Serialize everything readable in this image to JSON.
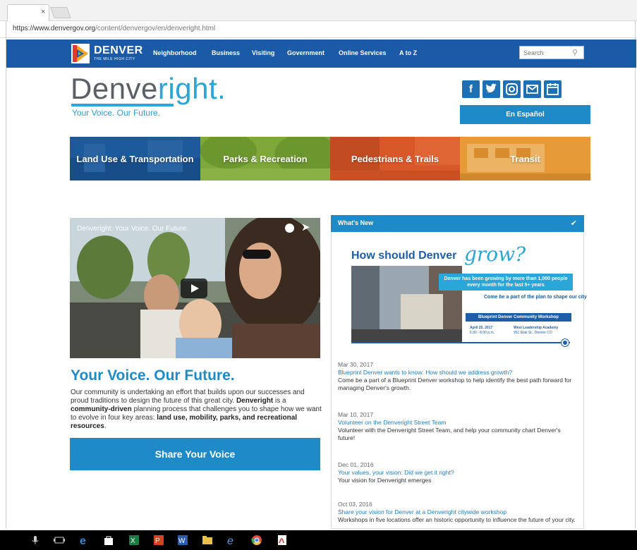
{
  "browser": {
    "tab_close": "×",
    "url_host": "https://www.denvergov.org",
    "url_path": "/content/denvergov/en/denveright.html"
  },
  "nav": {
    "logo_text": "DENVER",
    "logo_tagline": "THE MILE HIGH CITY",
    "links": [
      "Neighborhood",
      "Business",
      "Visiting",
      "Government",
      "Online Services",
      "A to Z"
    ],
    "search_placeholder": "Search"
  },
  "brand": {
    "part1": "Denve",
    "part2": "right.",
    "tagline": "Your Voice. Our Future."
  },
  "social": [
    "f",
    "t",
    "ig",
    "mail",
    "cal"
  ],
  "espanol_label": "En Español",
  "categories": [
    {
      "label": "Land Use & Transportation",
      "color": "#1d5a9c"
    },
    {
      "label": "Parks & Recreation",
      "color": "#7ea83a"
    },
    {
      "label": "Pedestrians & Trails",
      "color": "#d9582a"
    },
    {
      "label": "Transit",
      "color": "#e79a38"
    }
  ],
  "video": {
    "title": "Denveright: Your Voice. Our Future."
  },
  "main": {
    "heading": "Your Voice. Our Future.",
    "para1": "Our community is undertaking an effort that builds upon our successes and proud traditions to design the future of this great city.",
    "para2_bold1": "Denveright",
    "para2_mid": " is a ",
    "para2_bold2": "community-driven",
    "para2_mid2": " planning process that challenges you to shape how we want to evolve in four key areas: ",
    "para2_bold3": "land use, mobility, parks, and recreational resources",
    "para2_end": ".",
    "share_button": "Share Your Voice"
  },
  "whats_new": {
    "title": "What's New",
    "promo": {
      "question": "How should Denver",
      "grow": "grow?",
      "box1": "Denver has been growing by more than 1,000 people every month for the last 5+ years",
      "t2": "Come be a part of the plan to shape our city",
      "box2": "Blueprint Denver Community Workshop",
      "date": "April 25, 2017",
      "time": "5:30 - 8:00 p.m.",
      "venue": "West Leadership Academy",
      "address": "951 Elati St., Denver CO"
    },
    "items": [
      {
        "date": "Mar 30, 2017",
        "link": "Blueprint Denver wants to know: How should we address growth?",
        "text": "Come be a part of a Blueprint Denver workshop to help identify the best path forward for managing Denver's growth."
      },
      {
        "date": "Mar 10, 2017",
        "link": "Volunteer on the Denveright Street Team",
        "text": "Volunteer with the Denveright Street Team, and help your community chart Denver's future!"
      },
      {
        "date": "Dec 01, 2016",
        "link": "Your values, your vision: Did we get it right?",
        "text": "Your vision for Denveright emerges"
      },
      {
        "date": "Oct 03, 2016",
        "link": "Share your vision for Denver at a Denveright citywide workshop",
        "text": "Workshops in five locations offer an historic opportunity to influence the future of your city."
      }
    ]
  }
}
